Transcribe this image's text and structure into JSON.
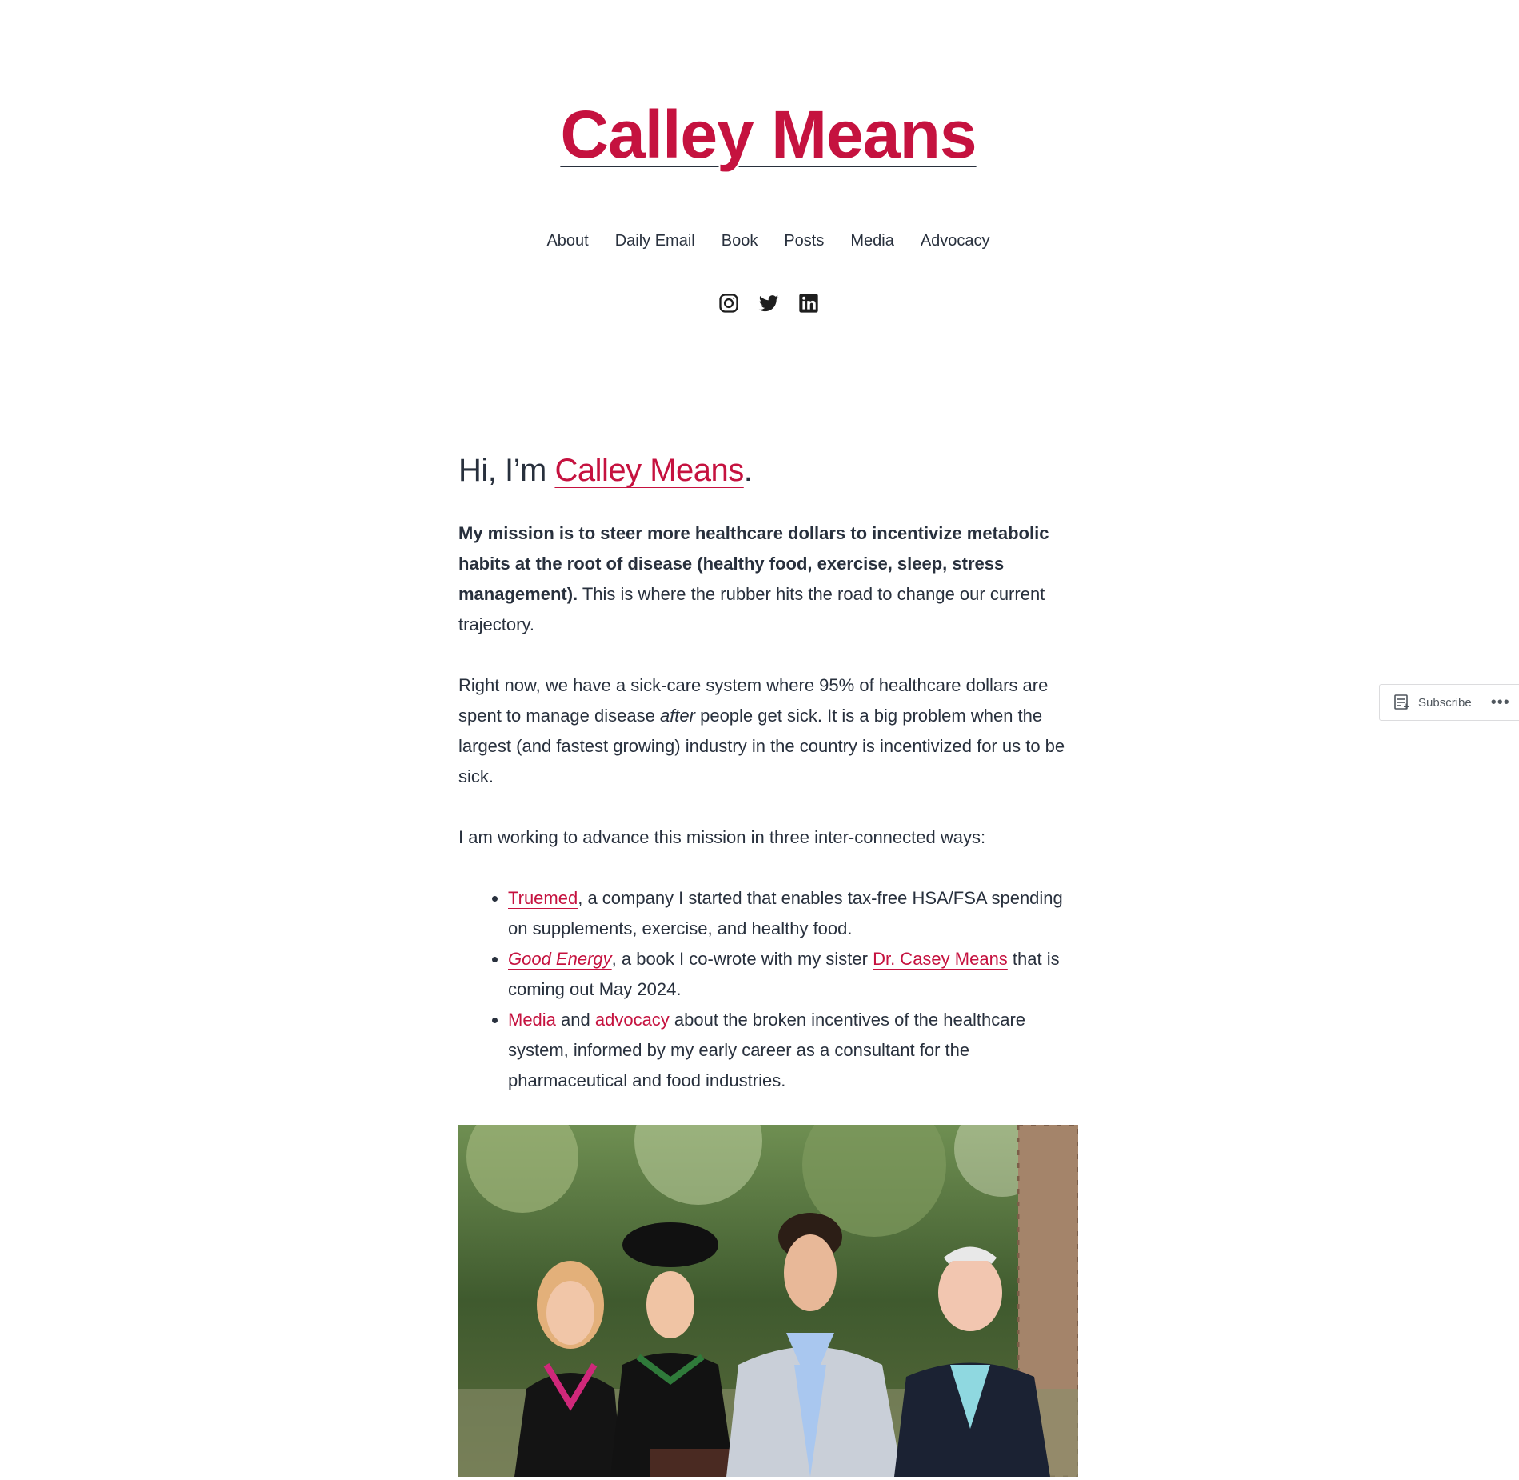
{
  "site": {
    "title": "Calley Means"
  },
  "nav": {
    "items": [
      "About",
      "Daily Email",
      "Book",
      "Posts",
      "Media",
      "Advocacy"
    ]
  },
  "social": {
    "icons": [
      "instagram-icon",
      "twitter-icon",
      "linkedin-icon"
    ]
  },
  "intro": {
    "greeting_prefix": "Hi, I’m ",
    "greeting_link": "Calley Means",
    "greeting_suffix": "."
  },
  "mission": {
    "bold": "My mission is to steer more healthcare dollars to incentivize metabolic habits at the root of disease (healthy food, exercise, sleep, stress management).",
    "rest": " This is where the rubber hits the road to change our current trajectory."
  },
  "problem": {
    "before": "Right now, we have a sick-care system where 95% of healthcare dollars are spent to manage disease ",
    "emphasis": "after",
    "after": " people get sick. It is a big problem when the largest (and fastest growing) industry in the country is incentivized for us to be sick."
  },
  "ways_intro": "I am working to advance this mission in three inter-connected ways:",
  "ways": {
    "truemed": {
      "link": "Truemed",
      "text": ", a company I started that enables tax-free HSA/FSA spending on supplements, exercise, and healthy food."
    },
    "book": {
      "link": "Good Energy",
      "text1": ", a book I co-wrote with my sister ",
      "link2": "Dr. Casey Means",
      "text2": " that is coming out May 2024."
    },
    "media": {
      "link1": "Media",
      "text1": " and ",
      "link2": "advocacy",
      "text2": " about the broken incentives of the healthcare system, informed by my early career as a consultant for the pharmaceutical and food industries."
    }
  },
  "subscribe": {
    "label": "Subscribe",
    "more": "•••"
  },
  "colors": {
    "accent": "#c5123f",
    "text": "#28303d",
    "background": "#ffffff"
  }
}
